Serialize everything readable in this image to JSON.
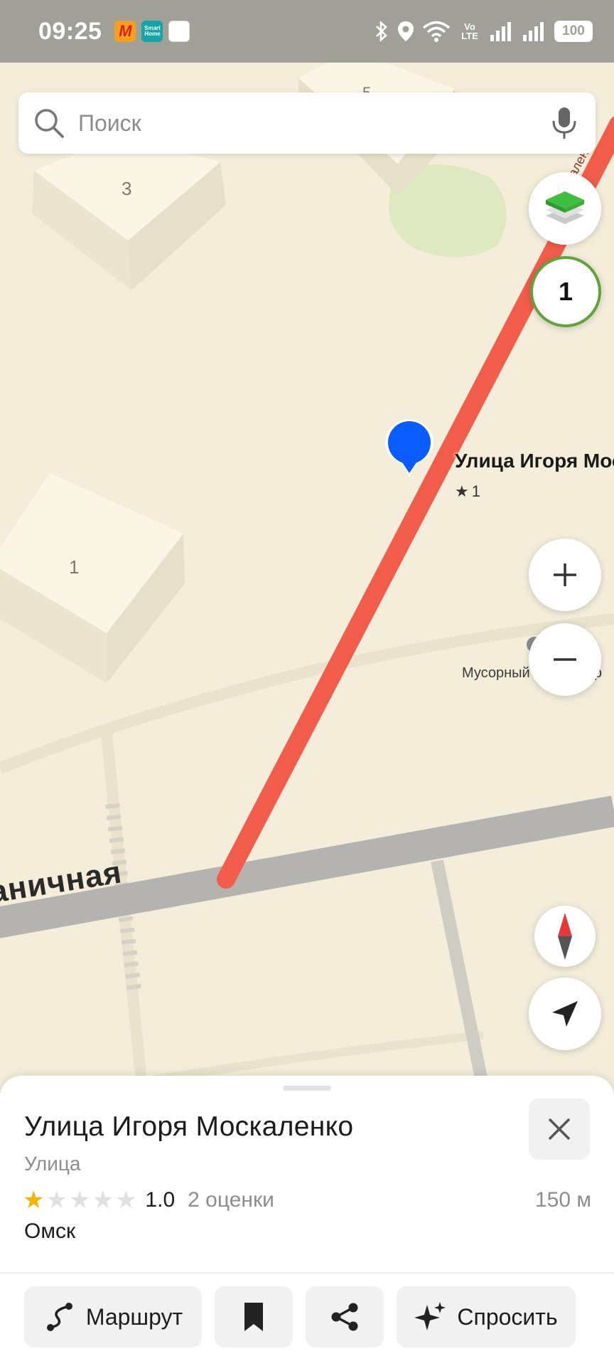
{
  "status_bar": {
    "time": "09:25",
    "app_icons": [
      {
        "name": "yandex-market-icon",
        "text": "M",
        "color": "#f7a01b"
      },
      {
        "name": "smart-home-icon",
        "text": "Smart Home",
        "color": "#14a6a6"
      },
      {
        "name": "notification-app-icon",
        "text": "",
        "color": "#ffffff"
      }
    ],
    "network": "Vo LTE",
    "battery": "100"
  },
  "search": {
    "placeholder": "Поиск"
  },
  "map": {
    "building_labels": [
      "3",
      "5",
      "1"
    ],
    "street_label": "аничная",
    "poi": {
      "title": "Улица Игоря Москаленко",
      "rating": "1"
    },
    "garbage_label": "Мусорный контейнер",
    "traffic_level": "1",
    "colors": {
      "route": "#f25c4a",
      "marker": "#0a5cff",
      "traffic_ring": "#62a23a",
      "land": "#f3edda",
      "building": "#fbf5e6",
      "road": "#b4b3b0"
    }
  },
  "place": {
    "name": "Улица Игоря Москаленко",
    "type": "Улица",
    "rating_value": "1.0",
    "rating_stars": 1,
    "rating_count": "2 оценки",
    "distance": "150 м",
    "city": "Омск"
  },
  "actions": {
    "route": "Маршрут",
    "ask": "Спросить"
  }
}
